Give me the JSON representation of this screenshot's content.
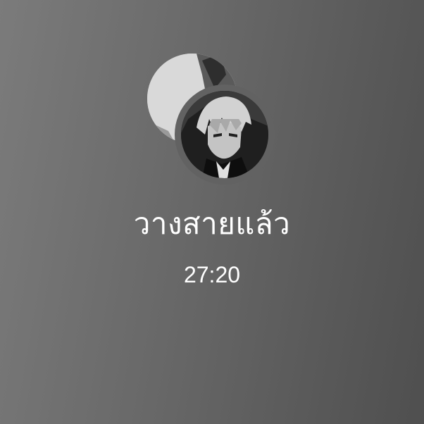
{
  "call": {
    "status": "วางสายแล้ว",
    "duration": "27:20"
  },
  "avatars": [
    {
      "name": "secondary-participant-avatar-icon"
    },
    {
      "name": "primary-participant-avatar-icon"
    }
  ]
}
